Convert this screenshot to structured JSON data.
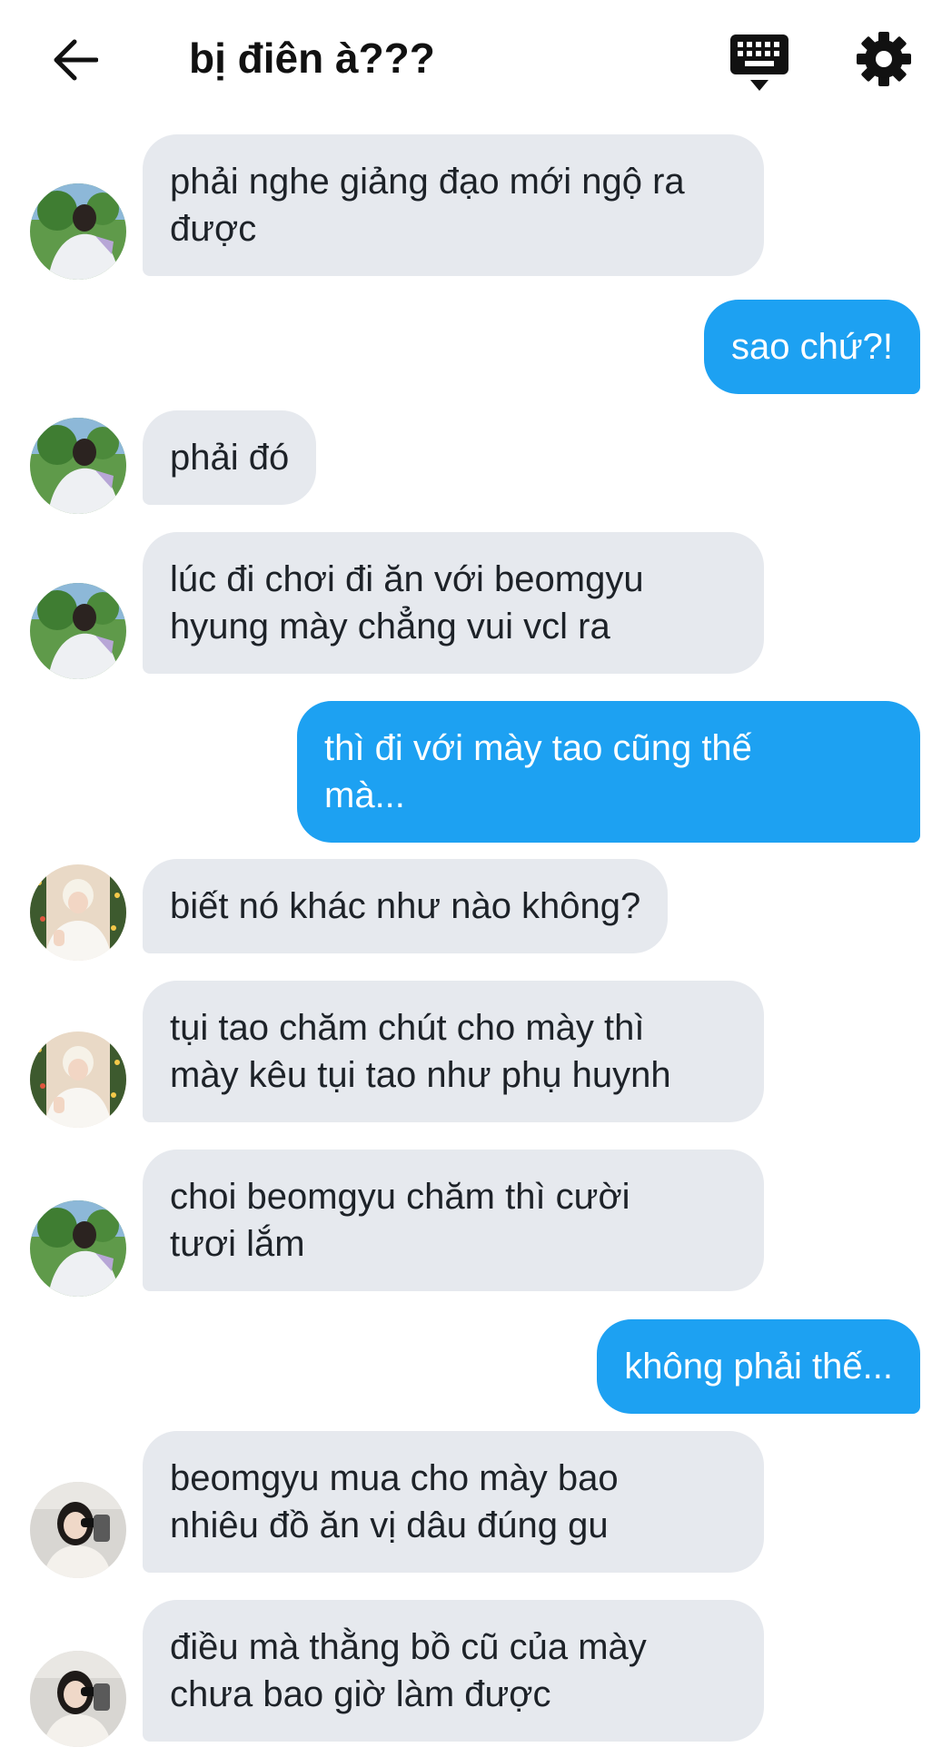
{
  "header": {
    "title": "bị điên à???",
    "back_icon": "arrow-left-icon",
    "keyboard_icon": "keyboard-icon",
    "settings_icon": "gear-icon"
  },
  "colors": {
    "incoming_bubble": "#e6e9ee",
    "outgoing_bubble": "#1da1f2"
  },
  "messages": [
    {
      "dir": "in",
      "avatar": "avatar-a",
      "text": "phải nghe giảng đạo mới ngộ ra\nđược"
    },
    {
      "dir": "out",
      "text": "sao chứ?!"
    },
    {
      "dir": "in",
      "avatar": "avatar-a",
      "text": "phải đó"
    },
    {
      "dir": "in",
      "avatar": "avatar-a",
      "text": "lúc đi chơi đi ăn với beomgyu\nhyung mày chẳng vui vcl ra"
    },
    {
      "dir": "out",
      "text": "thì đi với mày tao cũng thế\nmà..."
    },
    {
      "dir": "in",
      "avatar": "avatar-b",
      "text": "biết nó khác như nào không?"
    },
    {
      "dir": "in",
      "avatar": "avatar-b",
      "text": "tụi tao chăm chút cho mày thì\nmày kêu tụi tao như phụ huynh"
    },
    {
      "dir": "in",
      "avatar": "avatar-a",
      "text": "choi beomgyu chăm thì cười\ntươi lắm"
    },
    {
      "dir": "out",
      "text": "không phải thế..."
    },
    {
      "dir": "in",
      "avatar": "avatar-c",
      "text": "beomgyu mua cho mày bao\nnhiêu đồ ăn vị dâu đúng gu"
    },
    {
      "dir": "in",
      "avatar": "avatar-c",
      "text": "điều mà thằng bồ cũ của mày\nchưa bao giờ làm được"
    }
  ]
}
